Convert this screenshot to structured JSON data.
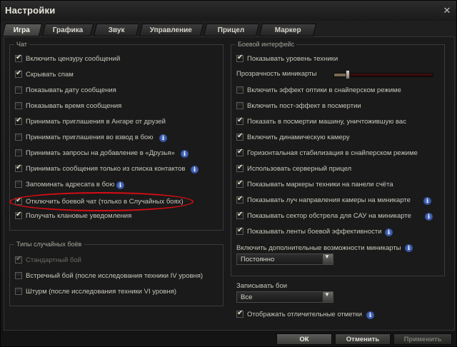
{
  "window": {
    "title": "Настройки",
    "close_glyph": "✕"
  },
  "tabs": [
    {
      "label": "Игра",
      "active": true
    },
    {
      "label": "Графика",
      "active": false
    },
    {
      "label": "Звук",
      "active": false
    },
    {
      "label": "Управление",
      "active": false
    },
    {
      "label": "Прицел",
      "active": false
    },
    {
      "label": "Маркер",
      "active": false
    }
  ],
  "chat": {
    "legend": "Чат",
    "items": [
      {
        "label": "Включить цензуру сообщений",
        "checked": true,
        "info": false
      },
      {
        "label": "Скрывать спам",
        "checked": true,
        "info": false
      },
      {
        "label": "Показывать дату сообщения",
        "checked": false,
        "info": false
      },
      {
        "label": "Показывать время сообщения",
        "checked": false,
        "info": false
      },
      {
        "label": "Принимать приглашения в Ангаре от друзей",
        "checked": true,
        "info": false
      },
      {
        "label": "Принимать приглашения во взвод в бою",
        "checked": false,
        "info": true
      },
      {
        "label": "Принимать запросы на добавление в «Друзья»",
        "checked": false,
        "info": true
      },
      {
        "label": "Принимать сообщения только из списка контактов",
        "checked": true,
        "info": true
      },
      {
        "label": "Запоминать адресата в бою",
        "checked": false,
        "info": true
      },
      {
        "label": "Отключить боевой чат (только в Случайных боях)",
        "checked": true,
        "info": false
      },
      {
        "label": "Получать клановые уведомления",
        "checked": true,
        "info": false
      }
    ]
  },
  "battle_types": {
    "legend": "Типы случайных боёв",
    "items": [
      {
        "label": "Стандартный бой",
        "checked": true,
        "disabled": true
      },
      {
        "label": "Встречный бой (после исследования техники IV уровня)",
        "checked": false,
        "disabled": false
      },
      {
        "label": "Штурм (после исследования техники VI уровня)",
        "checked": false,
        "disabled": false
      }
    ]
  },
  "battle_ui": {
    "legend": "Боевой интерфейс",
    "show_tier": {
      "label": "Показывать уровень техники",
      "checked": true
    },
    "minimap_transparency": {
      "label": "Прозрачность миникарты",
      "value_fraction": 0.14
    },
    "items": [
      {
        "label": "Включить эффект оптики в снайперском режиме",
        "checked": false,
        "info": false
      },
      {
        "label": "Включить пост-эффект в посмертии",
        "checked": false,
        "info": false
      },
      {
        "label": "Показать в посмертии машину, уничтожившую вас",
        "checked": true,
        "info": false
      },
      {
        "label": "Включить динамическую камеру",
        "checked": true,
        "info": false
      },
      {
        "label": "Горизонтальная стабилизация в снайперском режиме",
        "checked": true,
        "info": false
      },
      {
        "label": "Использовать серверный прицел",
        "checked": true,
        "info": false
      },
      {
        "label": "Показывать маркеры техники на панели счёта",
        "checked": true,
        "info": false
      },
      {
        "label": "Показывать луч направления камеры на миникарте",
        "checked": true,
        "info": true
      },
      {
        "label": "Показывать сектор обстрела для САУ на миникарте",
        "checked": true,
        "info": true
      },
      {
        "label": "Показывать ленты боевой эффективности",
        "checked": true,
        "info": true
      }
    ],
    "minimap_extra": {
      "label": "Включить дополнительные возможности миникарты",
      "value": "Постоянно"
    }
  },
  "replays": {
    "label": "Записывать бои",
    "value": "Все"
  },
  "marks": {
    "label": "Отображать отличительные отметки",
    "checked": true
  },
  "buttons": {
    "ok": "ОК",
    "cancel": "Отменить",
    "apply": "Применить"
  },
  "icons": {
    "check": "✔",
    "info": "i",
    "dropdown": "▼"
  },
  "colors": {
    "annotation": "#d80c14",
    "slider": "#4a1010"
  }
}
